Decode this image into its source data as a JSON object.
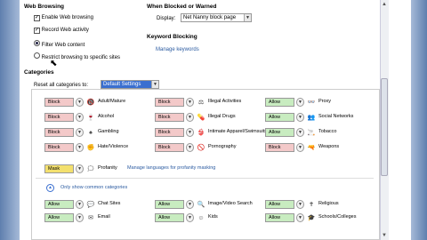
{
  "web_browsing": {
    "heading": "Web Browsing",
    "enable_web_browsing": "Enable Web browsing",
    "record_web_activity": "Record Web activity",
    "filter_web_content": "Filter Web content",
    "restrict_browsing": "Restrict browsing to specific sites"
  },
  "blocked": {
    "heading": "When Blocked or Warned",
    "display_label": "Display:",
    "display_value": "Net Nanny block page"
  },
  "keyword": {
    "heading": "Keyword Blocking",
    "manage_link": "Manage keywords"
  },
  "categories": {
    "heading": "Categories",
    "reset_label": "Reset all categories to:",
    "reset_value": "Default Settings",
    "rows": [
      [
        {
          "state": "Block",
          "icon": "adult-mature-icon",
          "glyph": "🔞",
          "label": "Adult/Mature"
        },
        {
          "state": "Block",
          "icon": "illegal-activities-icon",
          "glyph": "⚖",
          "label": "Illegal Activities"
        },
        {
          "state": "Allow",
          "icon": "proxy-icon",
          "glyph": "👓",
          "label": "Proxy"
        }
      ],
      [
        {
          "state": "Block",
          "icon": "alcohol-icon",
          "glyph": "🍷",
          "label": "Alcohol"
        },
        {
          "state": "Block",
          "icon": "illegal-drugs-icon",
          "glyph": "💊",
          "label": "Illegal Drugs"
        },
        {
          "state": "Allow",
          "icon": "social-networks-icon",
          "glyph": "👥",
          "label": "Social Networks"
        }
      ],
      [
        {
          "state": "Block",
          "icon": "gambling-icon",
          "glyph": "♠",
          "label": "Gambling"
        },
        {
          "state": "Block",
          "icon": "intimate-apparel-icon",
          "glyph": "👙",
          "label": "Intimate Apparel/Swimsuits"
        },
        {
          "state": "Allow",
          "icon": "tobacco-icon",
          "glyph": "🚬",
          "label": "Tobacco"
        }
      ],
      [
        {
          "state": "Block",
          "icon": "hate-violence-icon",
          "glyph": "✊",
          "label": "Hate/Violence"
        },
        {
          "state": "Block",
          "icon": "pornography-icon",
          "glyph": "🚫",
          "label": "Pornography"
        },
        {
          "state": "Block",
          "icon": "weapons-icon",
          "glyph": "🔫",
          "label": "Weapons"
        }
      ]
    ],
    "profanity": {
      "state": "Mask",
      "label": "Profanity",
      "manage_link": "Manage languages for profanity masking"
    },
    "common_link": "Only show common categories",
    "common_rows": [
      [
        {
          "state": "Allow",
          "icon": "chat-sites-icon",
          "glyph": "💬",
          "label": "Chat Sites"
        },
        {
          "state": "Allow",
          "icon": "image-video-search-icon",
          "glyph": "🔍",
          "label": "Image/Video Search"
        },
        {
          "state": "Allow",
          "icon": "religious-icon",
          "glyph": "✝",
          "label": "Religious"
        }
      ],
      [
        {
          "state": "Allow",
          "icon": "email-icon",
          "glyph": "✉",
          "label": "Email"
        },
        {
          "state": "Allow",
          "icon": "kids-icon",
          "glyph": "☺",
          "label": "Kids"
        },
        {
          "state": "Allow",
          "icon": "schools-colleges-icon",
          "glyph": "🎓",
          "label": "Schools/Colleges"
        }
      ]
    ]
  },
  "colors": {
    "block": "#f3c9c9",
    "allow": "#c8ecc0",
    "mask": "#f3e06e",
    "link": "#2a5aa0",
    "frame": "#5f7fae"
  }
}
